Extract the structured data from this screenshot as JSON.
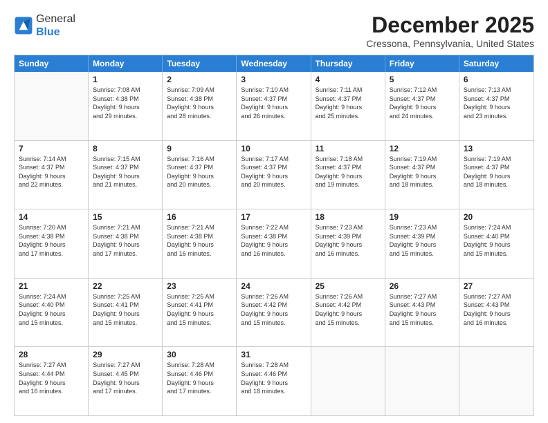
{
  "header": {
    "logo_general": "General",
    "logo_blue": "Blue",
    "month_title": "December 2025",
    "location": "Cressona, Pennsylvania, United States"
  },
  "days_of_week": [
    "Sunday",
    "Monday",
    "Tuesday",
    "Wednesday",
    "Thursday",
    "Friday",
    "Saturday"
  ],
  "rows": [
    [
      {
        "day": "",
        "lines": []
      },
      {
        "day": "1",
        "lines": [
          "Sunrise: 7:08 AM",
          "Sunset: 4:38 PM",
          "Daylight: 9 hours",
          "and 29 minutes."
        ]
      },
      {
        "day": "2",
        "lines": [
          "Sunrise: 7:09 AM",
          "Sunset: 4:38 PM",
          "Daylight: 9 hours",
          "and 28 minutes."
        ]
      },
      {
        "day": "3",
        "lines": [
          "Sunrise: 7:10 AM",
          "Sunset: 4:37 PM",
          "Daylight: 9 hours",
          "and 26 minutes."
        ]
      },
      {
        "day": "4",
        "lines": [
          "Sunrise: 7:11 AM",
          "Sunset: 4:37 PM",
          "Daylight: 9 hours",
          "and 25 minutes."
        ]
      },
      {
        "day": "5",
        "lines": [
          "Sunrise: 7:12 AM",
          "Sunset: 4:37 PM",
          "Daylight: 9 hours",
          "and 24 minutes."
        ]
      },
      {
        "day": "6",
        "lines": [
          "Sunrise: 7:13 AM",
          "Sunset: 4:37 PM",
          "Daylight: 9 hours",
          "and 23 minutes."
        ]
      }
    ],
    [
      {
        "day": "7",
        "lines": [
          "Sunrise: 7:14 AM",
          "Sunset: 4:37 PM",
          "Daylight: 9 hours",
          "and 22 minutes."
        ]
      },
      {
        "day": "8",
        "lines": [
          "Sunrise: 7:15 AM",
          "Sunset: 4:37 PM",
          "Daylight: 9 hours",
          "and 21 minutes."
        ]
      },
      {
        "day": "9",
        "lines": [
          "Sunrise: 7:16 AM",
          "Sunset: 4:37 PM",
          "Daylight: 9 hours",
          "and 20 minutes."
        ]
      },
      {
        "day": "10",
        "lines": [
          "Sunrise: 7:17 AM",
          "Sunset: 4:37 PM",
          "Daylight: 9 hours",
          "and 20 minutes."
        ]
      },
      {
        "day": "11",
        "lines": [
          "Sunrise: 7:18 AM",
          "Sunset: 4:37 PM",
          "Daylight: 9 hours",
          "and 19 minutes."
        ]
      },
      {
        "day": "12",
        "lines": [
          "Sunrise: 7:19 AM",
          "Sunset: 4:37 PM",
          "Daylight: 9 hours",
          "and 18 minutes."
        ]
      },
      {
        "day": "13",
        "lines": [
          "Sunrise: 7:19 AM",
          "Sunset: 4:37 PM",
          "Daylight: 9 hours",
          "and 18 minutes."
        ]
      }
    ],
    [
      {
        "day": "14",
        "lines": [
          "Sunrise: 7:20 AM",
          "Sunset: 4:38 PM",
          "Daylight: 9 hours",
          "and 17 minutes."
        ]
      },
      {
        "day": "15",
        "lines": [
          "Sunrise: 7:21 AM",
          "Sunset: 4:38 PM",
          "Daylight: 9 hours",
          "and 17 minutes."
        ]
      },
      {
        "day": "16",
        "lines": [
          "Sunrise: 7:21 AM",
          "Sunset: 4:38 PM",
          "Daylight: 9 hours",
          "and 16 minutes."
        ]
      },
      {
        "day": "17",
        "lines": [
          "Sunrise: 7:22 AM",
          "Sunset: 4:38 PM",
          "Daylight: 9 hours",
          "and 16 minutes."
        ]
      },
      {
        "day": "18",
        "lines": [
          "Sunrise: 7:23 AM",
          "Sunset: 4:39 PM",
          "Daylight: 9 hours",
          "and 16 minutes."
        ]
      },
      {
        "day": "19",
        "lines": [
          "Sunrise: 7:23 AM",
          "Sunset: 4:39 PM",
          "Daylight: 9 hours",
          "and 15 minutes."
        ]
      },
      {
        "day": "20",
        "lines": [
          "Sunrise: 7:24 AM",
          "Sunset: 4:40 PM",
          "Daylight: 9 hours",
          "and 15 minutes."
        ]
      }
    ],
    [
      {
        "day": "21",
        "lines": [
          "Sunrise: 7:24 AM",
          "Sunset: 4:40 PM",
          "Daylight: 9 hours",
          "and 15 minutes."
        ]
      },
      {
        "day": "22",
        "lines": [
          "Sunrise: 7:25 AM",
          "Sunset: 4:41 PM",
          "Daylight: 9 hours",
          "and 15 minutes."
        ]
      },
      {
        "day": "23",
        "lines": [
          "Sunrise: 7:25 AM",
          "Sunset: 4:41 PM",
          "Daylight: 9 hours",
          "and 15 minutes."
        ]
      },
      {
        "day": "24",
        "lines": [
          "Sunrise: 7:26 AM",
          "Sunset: 4:42 PM",
          "Daylight: 9 hours",
          "and 15 minutes."
        ]
      },
      {
        "day": "25",
        "lines": [
          "Sunrise: 7:26 AM",
          "Sunset: 4:42 PM",
          "Daylight: 9 hours",
          "and 15 minutes."
        ]
      },
      {
        "day": "26",
        "lines": [
          "Sunrise: 7:27 AM",
          "Sunset: 4:43 PM",
          "Daylight: 9 hours",
          "and 15 minutes."
        ]
      },
      {
        "day": "27",
        "lines": [
          "Sunrise: 7:27 AM",
          "Sunset: 4:43 PM",
          "Daylight: 9 hours",
          "and 16 minutes."
        ]
      }
    ],
    [
      {
        "day": "28",
        "lines": [
          "Sunrise: 7:27 AM",
          "Sunset: 4:44 PM",
          "Daylight: 9 hours",
          "and 16 minutes."
        ]
      },
      {
        "day": "29",
        "lines": [
          "Sunrise: 7:27 AM",
          "Sunset: 4:45 PM",
          "Daylight: 9 hours",
          "and 17 minutes."
        ]
      },
      {
        "day": "30",
        "lines": [
          "Sunrise: 7:28 AM",
          "Sunset: 4:46 PM",
          "Daylight: 9 hours",
          "and 17 minutes."
        ]
      },
      {
        "day": "31",
        "lines": [
          "Sunrise: 7:28 AM",
          "Sunset: 4:46 PM",
          "Daylight: 9 hours",
          "and 18 minutes."
        ]
      },
      {
        "day": "",
        "lines": []
      },
      {
        "day": "",
        "lines": []
      },
      {
        "day": "",
        "lines": []
      }
    ]
  ]
}
